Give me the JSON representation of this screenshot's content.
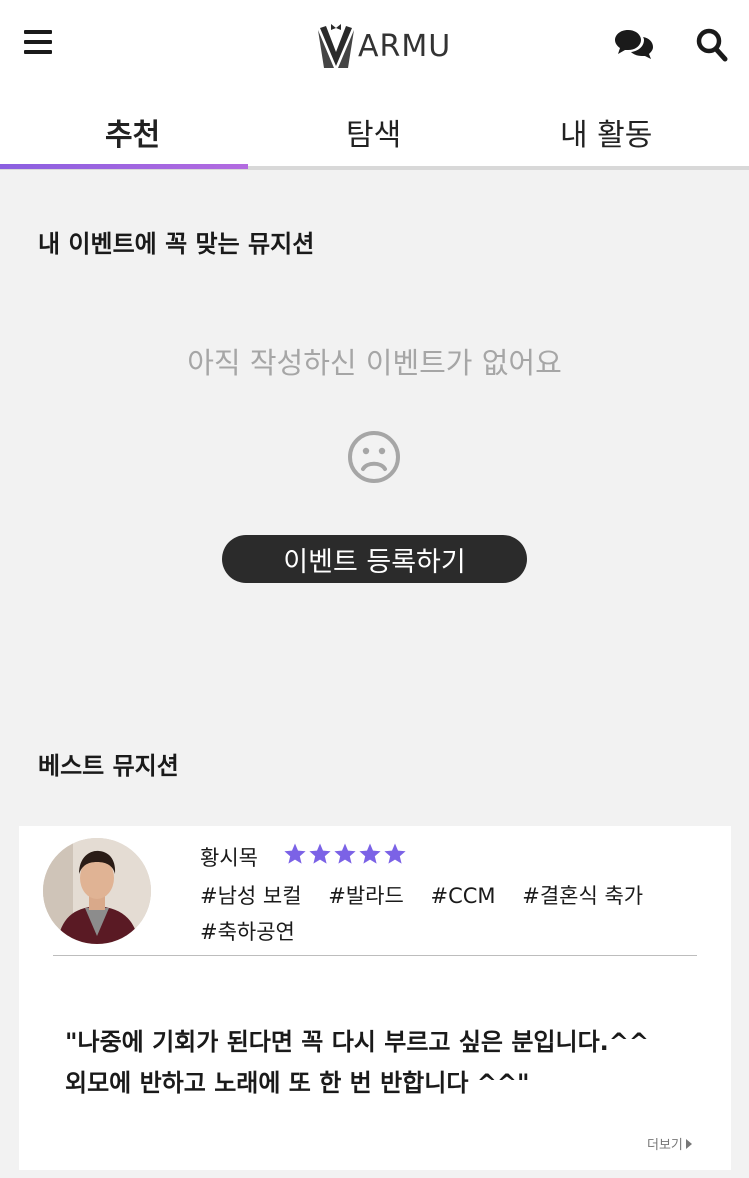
{
  "header": {
    "logo_text": "ARMU",
    "icons": [
      "menu-icon",
      "chat-icon",
      "search-icon"
    ]
  },
  "tabs": [
    {
      "label": "추천",
      "active": true
    },
    {
      "label": "탐색",
      "active": false
    },
    {
      "label": "내 활동",
      "active": false
    }
  ],
  "recommend_section": {
    "title": "내 이벤트에 꼭 맞는 뮤지션",
    "empty_message": "아직 작성하신 이벤트가 없어요",
    "empty_icon": "sad-face-icon",
    "register_button": "이벤트 등록하기"
  },
  "best_section": {
    "title": "베스트 뮤지션",
    "musician": {
      "name": "황시목",
      "rating": 5,
      "rating_max": 5,
      "tags": [
        "#남성 보컬",
        "#발라드",
        "#CCM",
        "#결혼식 축가",
        "#축하공연"
      ],
      "review_line1": "\"나중에 기회가 된다면 꼭 다시 부르고 싶은 분입니다.^^",
      "review_line2": "외모에 반하고 노래에 또 한 번 반합니다 ^^\"",
      "more_label": "더보기"
    }
  },
  "colors": {
    "accent": "#8a5fe0",
    "star": "#7b62e6",
    "button_bg": "#2b2b2b",
    "background": "#f2f2f2"
  }
}
